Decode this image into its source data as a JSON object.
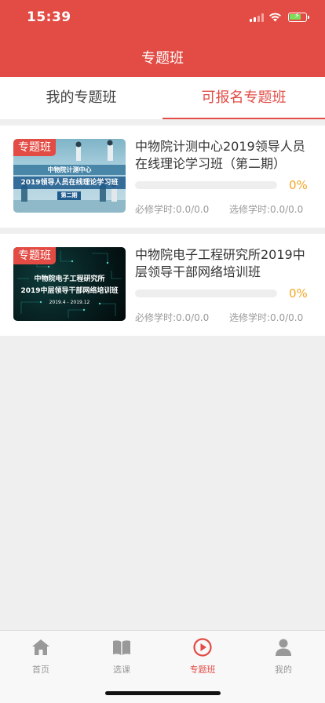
{
  "status_bar": {
    "time": "15:39"
  },
  "header": {
    "title": "专题班"
  },
  "tabs": [
    {
      "label": "我的专题班",
      "active": false
    },
    {
      "label": "可报名专题班",
      "active": true
    }
  ],
  "courses": [
    {
      "badge": "专题班",
      "title": "中物院计测中心2019领导人员在线理论学习班（第二期）",
      "thumb_lines": [
        "中物院计测中心",
        "2019领导人员在线理论学习班",
        "第二期"
      ],
      "progress_percent": 0,
      "percent_label": "0%",
      "required_hours": "必修学时:0.0/0.0",
      "elective_hours": "选修学时:0.0/0.0"
    },
    {
      "badge": "专题班",
      "title": "中物院电子工程研究所2019中层领导干部网络培训班",
      "thumb_lines": [
        "中物院电子工程研究所",
        "2019中层领导干部网络培训班",
        "2019.4 - 2019.12"
      ],
      "progress_percent": 0,
      "percent_label": "0%",
      "required_hours": "必修学时:0.0/0.0",
      "elective_hours": "选修学时:0.0/0.0"
    }
  ],
  "bottom_nav": [
    {
      "label": "首页",
      "icon": "home-icon",
      "active": false
    },
    {
      "label": "选课",
      "icon": "book-icon",
      "active": false
    },
    {
      "label": "专题班",
      "icon": "play-circle-icon",
      "active": true
    },
    {
      "label": "我的",
      "icon": "user-icon",
      "active": false
    }
  ],
  "colors": {
    "primary": "#e24c45",
    "progress": "#f5a623",
    "background": "#efefef"
  }
}
